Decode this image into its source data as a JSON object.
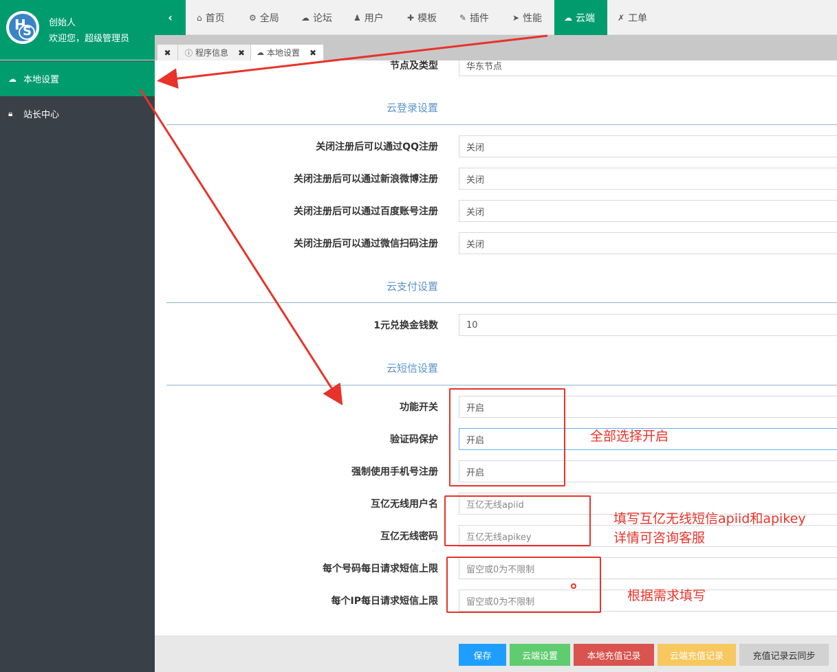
{
  "user": {
    "name": "创始人",
    "welcome": "欢迎您，超级管理员"
  },
  "sidebar": {
    "items": [
      {
        "label": "本地设置",
        "icon": "cloud-icon",
        "active": true
      },
      {
        "label": "站长中心",
        "icon": "lock-icon",
        "active": false
      }
    ]
  },
  "topnav": {
    "collapse_icon": "‹",
    "items": [
      {
        "label": "首页",
        "icon": "home-icon",
        "glyph": "⌂"
      },
      {
        "label": "全局",
        "icon": "gears-icon",
        "glyph": "⚙"
      },
      {
        "label": "论坛",
        "icon": "comments-icon",
        "glyph": "☁"
      },
      {
        "label": "用户",
        "icon": "users-icon",
        "glyph": "♟"
      },
      {
        "label": "模板",
        "icon": "puzzle-icon",
        "glyph": "✚"
      },
      {
        "label": "插件",
        "icon": "plug-icon",
        "glyph": "✎"
      },
      {
        "label": "性能",
        "icon": "send-icon",
        "glyph": "➤"
      },
      {
        "label": "云端",
        "icon": "cloud-icon",
        "glyph": "☁",
        "active": true
      },
      {
        "label": "工单",
        "icon": "wrench-icon",
        "glyph": "✗"
      }
    ]
  },
  "tabs": [
    {
      "label": "",
      "closable": true
    },
    {
      "label": "程序信息",
      "icon": "info-icon",
      "closable": true
    },
    {
      "label": "本地设置",
      "icon": "cloud-icon",
      "closable": true,
      "active": true
    }
  ],
  "form": {
    "node_label": "节点及类型",
    "node_value": "华东节点",
    "section_login": "云登录设置",
    "login_rows": [
      {
        "label": "关闭注册后可以通过QQ注册",
        "value": "关闭"
      },
      {
        "label": "关闭注册后可以通过新浪微博注册",
        "value": "关闭"
      },
      {
        "label": "关闭注册后可以通过百度账号注册",
        "value": "关闭"
      },
      {
        "label": "关闭注册后可以通过微信扫码注册",
        "value": "关闭"
      }
    ],
    "section_pay": "云支付设置",
    "pay_rows": [
      {
        "label": "1元兑换金钱数",
        "value": "10"
      }
    ],
    "section_sms": "云短信设置",
    "sms_rows": [
      {
        "label": "功能开关",
        "value": "开启"
      },
      {
        "label": "验证码保护",
        "value": "开启"
      },
      {
        "label": "强制使用手机号注册",
        "value": "开启"
      },
      {
        "label": "互亿无线用户名",
        "value": "",
        "placeholder": "互亿无线apiid"
      },
      {
        "label": "互亿无线密码",
        "value": "",
        "placeholder": "互亿无线apikey"
      },
      {
        "label": "每个号码每日请求短信上限",
        "value": "",
        "placeholder": "留空或0为不限制"
      },
      {
        "label": "每个IP每日请求短信上限",
        "value": "",
        "placeholder": "留空或0为不限制"
      }
    ]
  },
  "buttons": {
    "save": "保存",
    "cloud_settings": "云端设置",
    "local_recharge": "本地充值记录",
    "cloud_recharge": "云端充值记录",
    "sync_recharge": "充值记录云同步"
  },
  "colors": {
    "brand": "#009c6e",
    "sidebar_bg": "#3a4048",
    "save": "#1e9fff",
    "cloud_settings": "#5fcc6f",
    "local_recharge": "#d9534f",
    "cloud_recharge": "#f6c85f",
    "sync_recharge": "#d2d2d2",
    "annotation": "#e8332a"
  },
  "annotations": {
    "select_all_open": "全部选择开启",
    "fill_api_line1": "填写互亿无线短信apiid和apikey",
    "fill_api_line2": "详情可咨询客服",
    "fill_as_needed": "根据需求填写"
  }
}
